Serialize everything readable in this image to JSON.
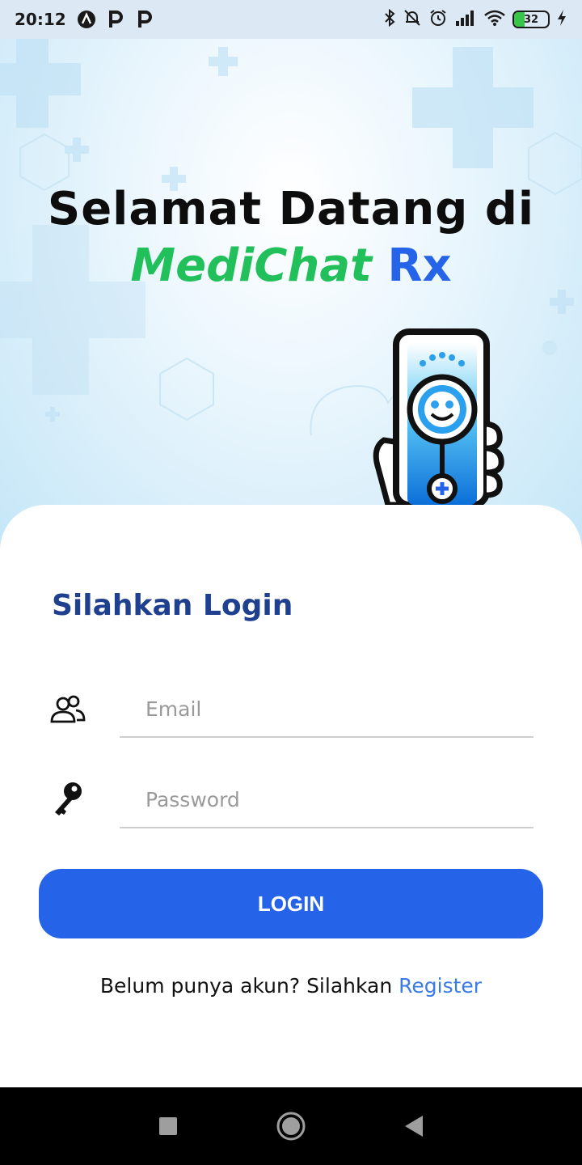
{
  "status_bar": {
    "time": "20:12",
    "app_icons": [
      "a-icon",
      "p-icon",
      "p-icon"
    ],
    "battery_level": "32",
    "icons": [
      "bluetooth-icon",
      "mute-icon",
      "alarm-icon",
      "signal-icon",
      "wifi-icon",
      "battery-icon",
      "charging-icon"
    ]
  },
  "hero": {
    "title_line1": "Selamat Datang di",
    "brand_part1": "MediChat",
    "brand_part2": "Rx",
    "illustration": "phone-stethoscope-illustration"
  },
  "login": {
    "heading": "Silahkan Login",
    "email_placeholder": "Email",
    "password_placeholder": "Password",
    "button_label": "LOGIN",
    "register_prompt": "Belum punya akun? Silahkan ",
    "register_link": "Register"
  },
  "colors": {
    "primary": "#2563e8",
    "brand_green": "#22c05a",
    "heading_blue": "#1f3f8f",
    "link_blue": "#3b7be6"
  },
  "nav_bar": {
    "buttons": [
      "recents-square-icon",
      "home-circle-icon",
      "back-triangle-icon"
    ]
  }
}
